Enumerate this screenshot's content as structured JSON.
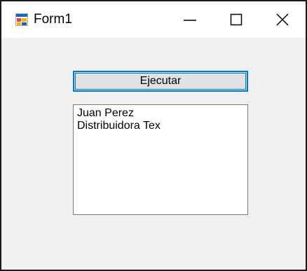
{
  "window": {
    "title": "Form1",
    "icon": "winforms-app-icon",
    "controls": {
      "minimize_icon": "minimize-icon",
      "maximize_icon": "maximize-icon",
      "close_icon": "close-icon"
    }
  },
  "form": {
    "button_label": "Ejecutar",
    "listbox_items": [
      "Juan Perez",
      "Distribuidora Tex"
    ]
  },
  "colors": {
    "focus_border": "#0078d7",
    "button_face": "#e1e1e1",
    "form_background": "#f0f0f0",
    "titlebar_background": "#ffffff"
  }
}
